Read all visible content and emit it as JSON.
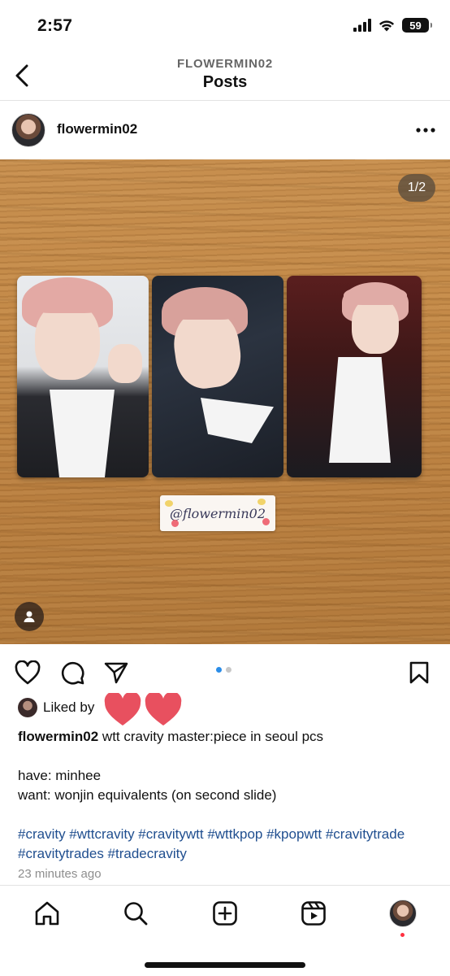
{
  "status_bar": {
    "time": "2:57",
    "battery": "59",
    "icons": [
      "signal-icon",
      "wifi-icon",
      "battery-icon"
    ]
  },
  "header": {
    "subtitle": "FLOWERMIN02",
    "title": "Posts"
  },
  "post": {
    "username": "flowermin02",
    "slide_counter": "1/2",
    "current_slide": 1,
    "total_slides": 2,
    "photo_tag_text": "@flowermin02",
    "likes_text": "Liked by",
    "caption_username": "flowermin02",
    "caption_text": " wtt cravity master:piece in seoul pcs",
    "caption_have": "have: minhee",
    "caption_want": "want: wonjin equivalents (on second slide)",
    "hashtags": "#cravity #wttcravity #cravitywtt #wttkpop #kpopwtt #cravitytrade #cravitytrades #tradecravity",
    "timestamp": "23 minutes ago"
  },
  "colors": {
    "hashtag": "#1f4e8f",
    "active_dot": "#2b8de8",
    "heart_sticker": "#e8505f",
    "notification": "#ff3040"
  },
  "tab_bar": {
    "items": [
      "home-icon",
      "search-icon",
      "create-icon",
      "reels-icon",
      "profile-avatar"
    ]
  }
}
